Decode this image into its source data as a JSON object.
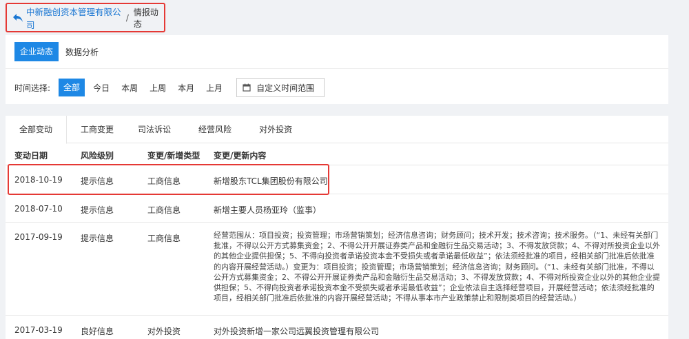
{
  "breadcrumb": {
    "company": "中新融创资本管理有限公司",
    "separator": "/",
    "current": "情报动态"
  },
  "view_tabs": {
    "active": "企业动态",
    "other": "数据分析"
  },
  "time_filter": {
    "label": "时间选择:",
    "options": [
      "全部",
      "今日",
      "本周",
      "上周",
      "本月",
      "上月"
    ],
    "custom_label": "自定义时间范围"
  },
  "category_tabs": [
    "全部变动",
    "工商变更",
    "司法诉讼",
    "经营风险",
    "对外投资"
  ],
  "table": {
    "headers": [
      "变动日期",
      "风险级别",
      "变更/新增类型",
      "变更/更新内容"
    ],
    "rows": [
      {
        "date": "2018-10-19",
        "level": "提示信息",
        "type": "工商信息",
        "content": "新增股东TCL集团股份有限公司"
      },
      {
        "date": "2018-07-10",
        "level": "提示信息",
        "type": "工商信息",
        "content": "新增主要人员杨亚玲（监事）"
      },
      {
        "date": "2017-09-19",
        "level": "提示信息",
        "type": "工商信息",
        "content": "经营范围从：项目投资；投资管理；市场营销策划；经济信息咨询；财务顾问；技术开发；技术咨询；技术服务。（“1、未经有关部门批准，不得以公开方式募集资金；2、不得公开开展证券类产品和金融衍生品交易活动；3、不得发放贷款；4、不得对所投资企业以外的其他企业提供担保；5、不得向投资者承诺投资本金不受损失或者承诺最低收益”；依法须经批准的项目，经相关部门批准后依批准的内容开展经营活动。）变更为：项目投资；投资管理；市场营销策划；经济信息咨询；财务顾问。（“1、未经有关部门批准，不得以公开方式募集资金；2、不得公开开展证券类产品和金融衍生品交易活动；3、不得发放贷款；4、不得对所投资企业以外的其他企业提供担保；5、不得向投资者承诺投资本金不受损失或者承诺最低收益”；企业依法自主选择经营项目，开展经营活动；依法须经批准的项目，经相关部门批准后依批准的内容开展经营活动；不得从事本市产业政策禁止和限制类项目的经营活动。）"
      },
      {
        "date": "2017-03-19",
        "level": "良好信息",
        "type": "对外投资",
        "content": "对外投资新增一家公司远翼投资管理有限公司"
      }
    ]
  },
  "icons": {
    "back": "back-arrow-icon",
    "calendar": "calendar-icon"
  },
  "colors": {
    "accent": "#1e88e5",
    "link": "#1976d2",
    "highlight": "#e53935"
  }
}
